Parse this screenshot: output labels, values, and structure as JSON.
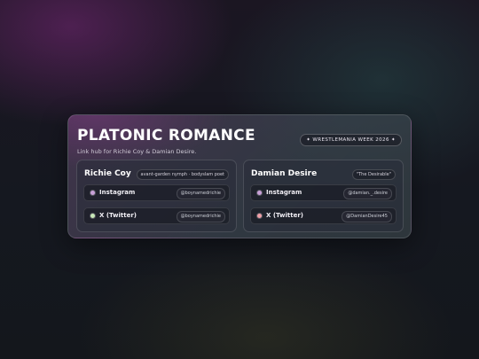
{
  "header": {
    "title": "PLATONIC ROMANCE",
    "subtitle": "Link hub for Richie Coy & Damian Desire.",
    "event_badge": "✦ WRESTLEMANIA WEEK 2026 ✦"
  },
  "members": [
    {
      "name": "Richie Coy",
      "tag": "avant-garden nymph · bodyslam poet",
      "links": [
        {
          "label": "Instagram",
          "handle": "@boynamedrichie",
          "dot_color": "#c9a0d8"
        },
        {
          "label": "X (Twitter)",
          "handle": "@boynamedrichie",
          "dot_color": "#c8e8b8"
        }
      ]
    },
    {
      "name": "Damian Desire",
      "tag": "\"The Desirable\"",
      "links": [
        {
          "label": "Instagram",
          "handle": "@damian._.desire",
          "dot_color": "#c9a0d8"
        },
        {
          "label": "X (Twitter)",
          "handle": "@DamianDesire45",
          "dot_color": "#f0a0a8"
        }
      ]
    }
  ]
}
